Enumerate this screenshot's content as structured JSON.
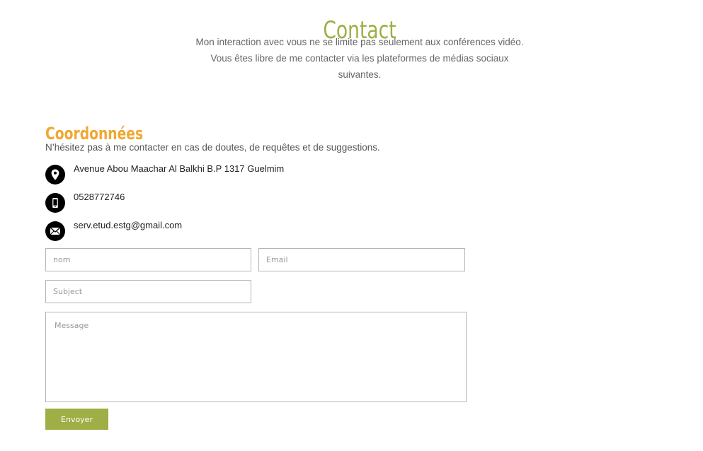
{
  "header": {
    "title": "Contact",
    "intro_lines": [
      "Mon interaction avec vous ne se limite pas seulement aux conférences vidéo.",
      "Vous êtes libre de me contacter via les plateformes de médias sociaux",
      "suivantes."
    ]
  },
  "contact": {
    "title": "Coordonnées",
    "description": "N’hésitez pas à me contacter en cas de doutes, de requêtes et de suggestions.",
    "items": [
      {
        "icon": "location-pin-icon",
        "text": "Avenue Abou Maachar Al Balkhi B.P 1317 Guelmim"
      },
      {
        "icon": "mobile-phone-icon",
        "text": "0528772746"
      },
      {
        "icon": "envelope-icon",
        "text": "serv.etud.estg@gmail.com"
      }
    ]
  },
  "form": {
    "name_placeholder": "nom",
    "email_placeholder": "Email",
    "subject_placeholder": "Subject",
    "message_placeholder": "Message",
    "submit_label": "Envoyer"
  },
  "colors": {
    "accent_green": "#9fae45",
    "heading_orange": "#f0a832",
    "icon_background": "#000000"
  }
}
